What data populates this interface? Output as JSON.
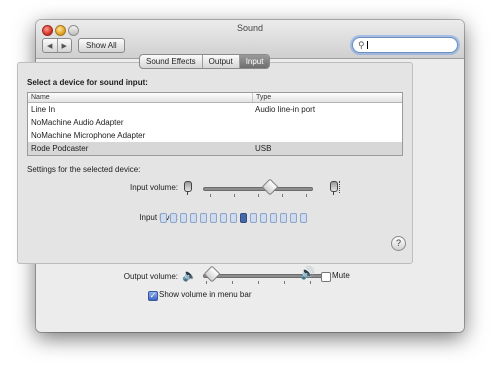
{
  "window": {
    "title": "Sound"
  },
  "toolbar": {
    "back_label": "◀",
    "forward_label": "▶",
    "show_all_label": "Show All",
    "search_value": ""
  },
  "tabs": [
    {
      "label": "Sound Effects",
      "active": false
    },
    {
      "label": "Output",
      "active": false
    },
    {
      "label": "Input",
      "active": true
    }
  ],
  "input": {
    "prompt": "Select a device for sound input:",
    "columns": {
      "name": "Name",
      "type": "Type"
    },
    "devices": [
      {
        "name": "Line In",
        "type": "Audio line-in port",
        "selected": false
      },
      {
        "name": "NoMachine Audio Adapter",
        "type": "",
        "selected": false
      },
      {
        "name": "NoMachine Microphone Adapter",
        "type": "",
        "selected": false
      },
      {
        "name": "Rode Podcaster",
        "type": "USB",
        "selected": true
      }
    ],
    "settings_label": "Settings for the selected device:",
    "volume_label": "Input volume:",
    "volume_value": 0.62,
    "level_label": "Input level:",
    "level_total": 15,
    "level_active_index": 8
  },
  "help_label": "?",
  "output": {
    "volume_label": "Output volume:",
    "volume_value": 0.08,
    "mute_label": "Mute",
    "mute_checked": false,
    "menu_bar_label": "Show volume in menu bar",
    "menu_bar_checked": true
  }
}
